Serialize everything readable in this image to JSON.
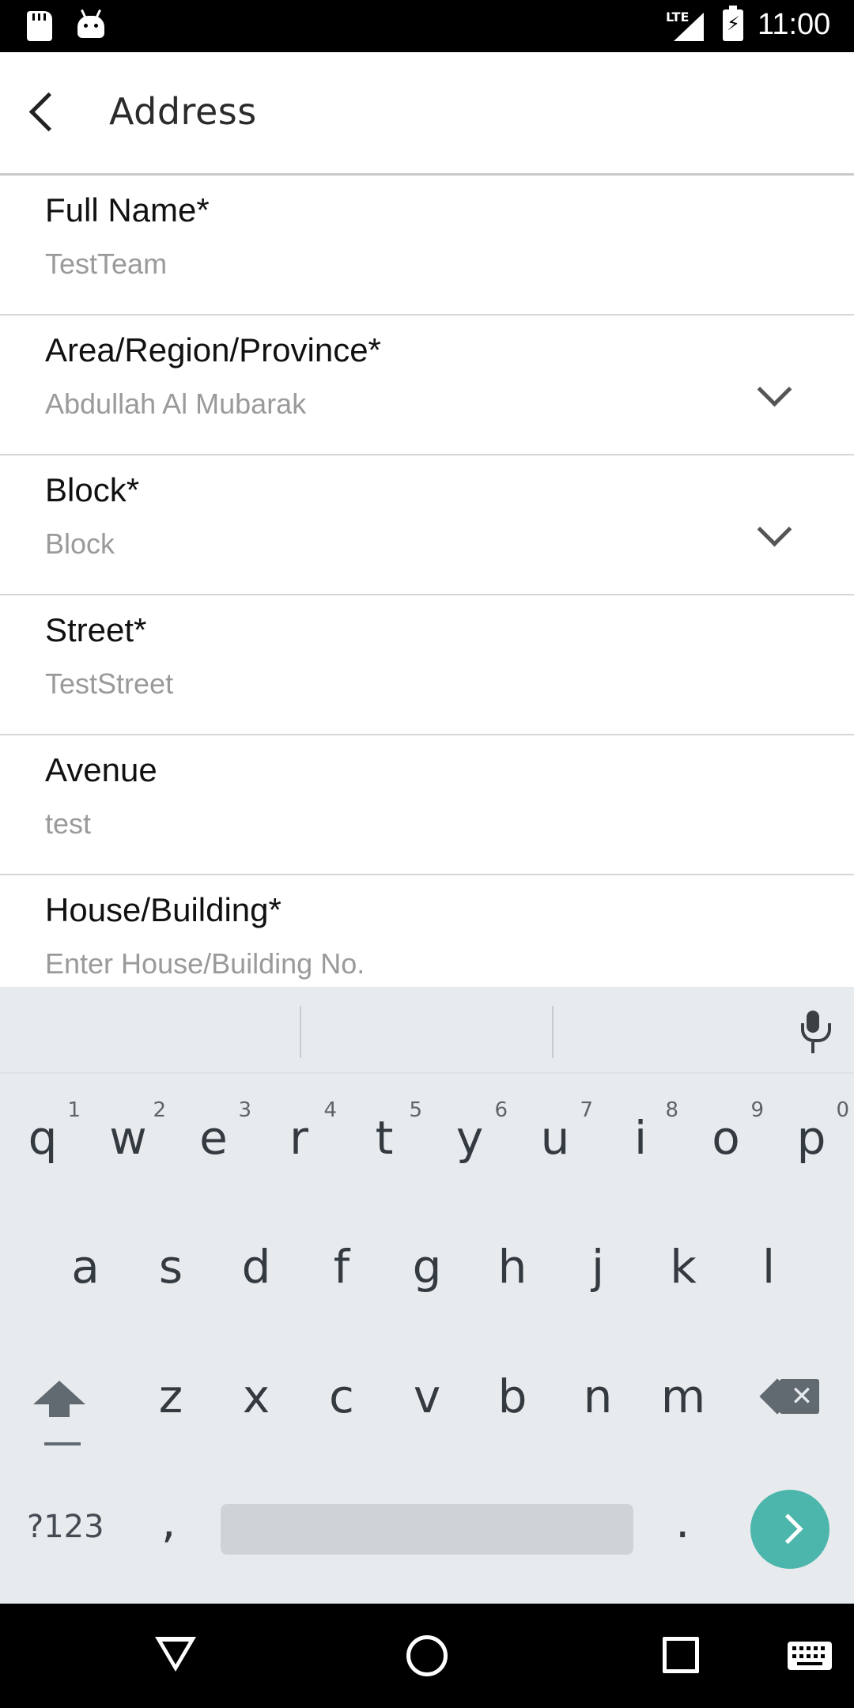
{
  "status_bar": {
    "network": "LTE",
    "time": "11:00",
    "icons": [
      "sd-card-icon",
      "android-icon",
      "lte-signal-icon",
      "battery-charging-icon"
    ]
  },
  "app_bar": {
    "title": "Address",
    "back_icon": "back-arrow-icon"
  },
  "form": {
    "fields": [
      {
        "label": "Full Name*",
        "value": "TestTeam",
        "type": "text"
      },
      {
        "label": "Area/Region/Province*",
        "value": "Abdullah Al Mubarak",
        "type": "dropdown"
      },
      {
        "label": "Block*",
        "value": "Block",
        "type": "dropdown"
      },
      {
        "label": "Street*",
        "value": "TestStreet",
        "type": "text"
      },
      {
        "label": "Avenue",
        "value": "test",
        "type": "text"
      },
      {
        "label": "House/Building*",
        "placeholder": "Enter House/Building No.",
        "type": "text"
      }
    ]
  },
  "keyboard": {
    "row1": [
      {
        "key": "q",
        "hint": "1"
      },
      {
        "key": "w",
        "hint": "2"
      },
      {
        "key": "e",
        "hint": "3"
      },
      {
        "key": "r",
        "hint": "4"
      },
      {
        "key": "t",
        "hint": "5"
      },
      {
        "key": "y",
        "hint": "6"
      },
      {
        "key": "u",
        "hint": "7"
      },
      {
        "key": "i",
        "hint": "8"
      },
      {
        "key": "o",
        "hint": "9"
      },
      {
        "key": "p",
        "hint": "0"
      }
    ],
    "row2": [
      "a",
      "s",
      "d",
      "f",
      "g",
      "h",
      "j",
      "k",
      "l"
    ],
    "row3": [
      "z",
      "x",
      "c",
      "v",
      "b",
      "n",
      "m"
    ],
    "symbols_label": "?123",
    "comma": ",",
    "period": ".",
    "accent_color": "#4db6ac"
  },
  "nav_bar": {
    "icons": [
      "back-triangle-icon",
      "home-circle-icon",
      "recents-square-icon",
      "keyboard-icon"
    ]
  }
}
